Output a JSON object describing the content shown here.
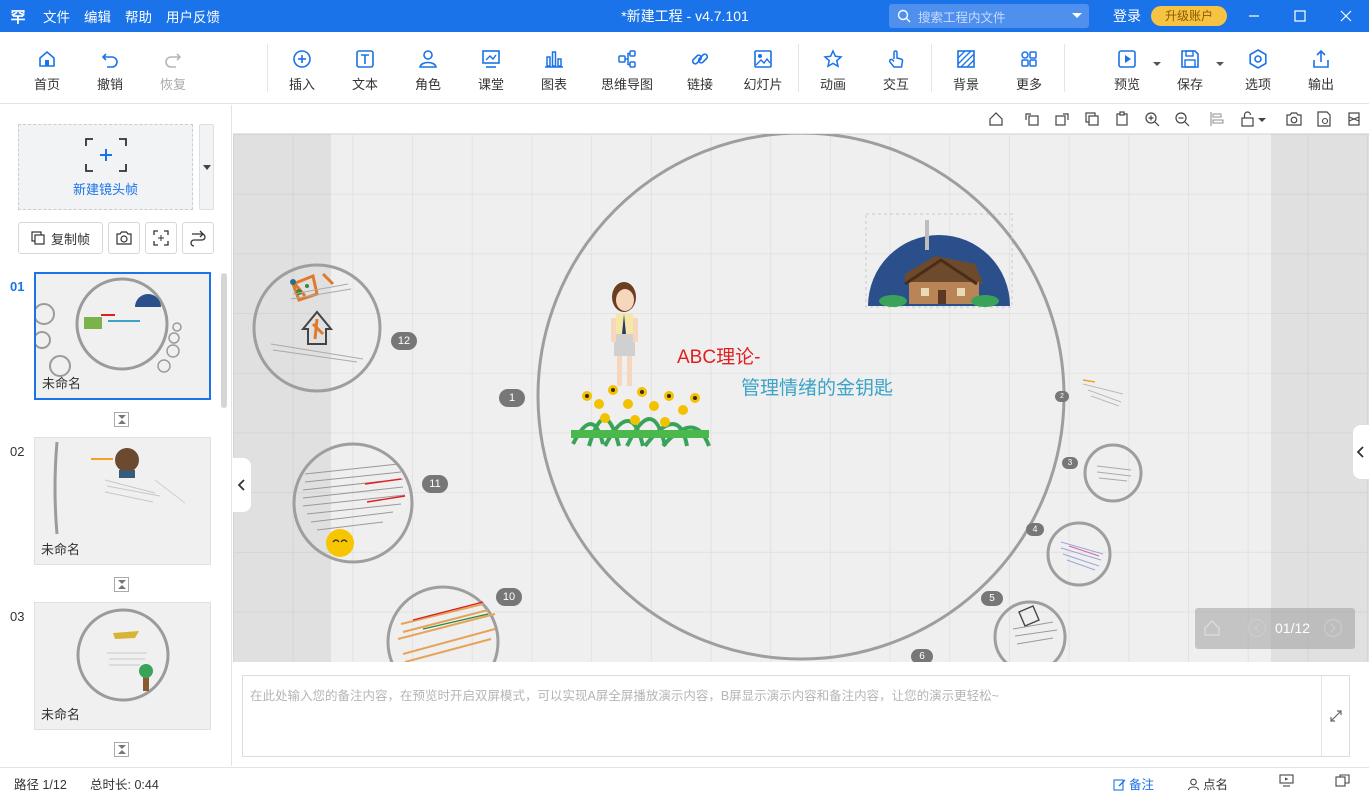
{
  "app": {
    "logo": "罕",
    "menu": [
      "文件",
      "编辑",
      "帮助",
      "用户反馈"
    ],
    "window_title": "*新建工程 - v4.7.101",
    "search_placeholder": "搜索工程内文件",
    "login": "登录",
    "upgrade": "升级账户"
  },
  "toolbar": {
    "items": [
      {
        "label": "首页",
        "icon": "home-icon"
      },
      {
        "label": "撤销",
        "icon": "undo-icon"
      },
      {
        "label": "恢复",
        "icon": "redo-icon"
      },
      {
        "label": "插入",
        "icon": "plus-circle-icon"
      },
      {
        "label": "文本",
        "icon": "text-icon"
      },
      {
        "label": "角色",
        "icon": "person-icon"
      },
      {
        "label": "课堂",
        "icon": "classroom-icon"
      },
      {
        "label": "图表",
        "icon": "bar-chart-icon"
      },
      {
        "label": "思维导图",
        "icon": "mindmap-icon"
      },
      {
        "label": "链接",
        "icon": "link-icon"
      },
      {
        "label": "幻灯片",
        "icon": "slideshow-icon"
      },
      {
        "label": "动画",
        "icon": "star-icon"
      },
      {
        "label": "交互",
        "icon": "hand-pointer-icon"
      },
      {
        "label": "背景",
        "icon": "background-icon"
      },
      {
        "label": "更多",
        "icon": "grid-icon"
      },
      {
        "label": "预览",
        "icon": "play-icon"
      },
      {
        "label": "保存",
        "icon": "save-icon"
      },
      {
        "label": "选项",
        "icon": "options-icon"
      },
      {
        "label": "输出",
        "icon": "export-icon"
      }
    ]
  },
  "left": {
    "new_frame": "新建镜头帧",
    "copy_frame": "复制帧",
    "slides": [
      {
        "num": "01",
        "name": "未命名"
      },
      {
        "num": "02",
        "name": "未命名"
      },
      {
        "num": "03",
        "name": "未命名"
      }
    ]
  },
  "canvas": {
    "title_red": "ABC理论-",
    "title_blue": "管理情绪的金钥匙",
    "markers": [
      "1",
      "12",
      "11",
      "10",
      "2",
      "3",
      "4",
      "5",
      "6"
    ],
    "nav_counter": "01/12"
  },
  "notes": {
    "placeholder": "在此处输入您的备注内容，在预览时开启双屏模式，可以实现A屏全屏播放演示内容，B屏显示演示内容和备注内容，让您的演示更轻松~"
  },
  "status": {
    "path": "路径 1/12",
    "duration": "总时长: 0:44",
    "notes_btn": "备注",
    "rollcall_btn": "点名"
  },
  "colors": {
    "brand": "#1a73e8",
    "upgrade": "#f6c343",
    "title_red": "#e02020",
    "title_blue": "#3aa3c6"
  }
}
